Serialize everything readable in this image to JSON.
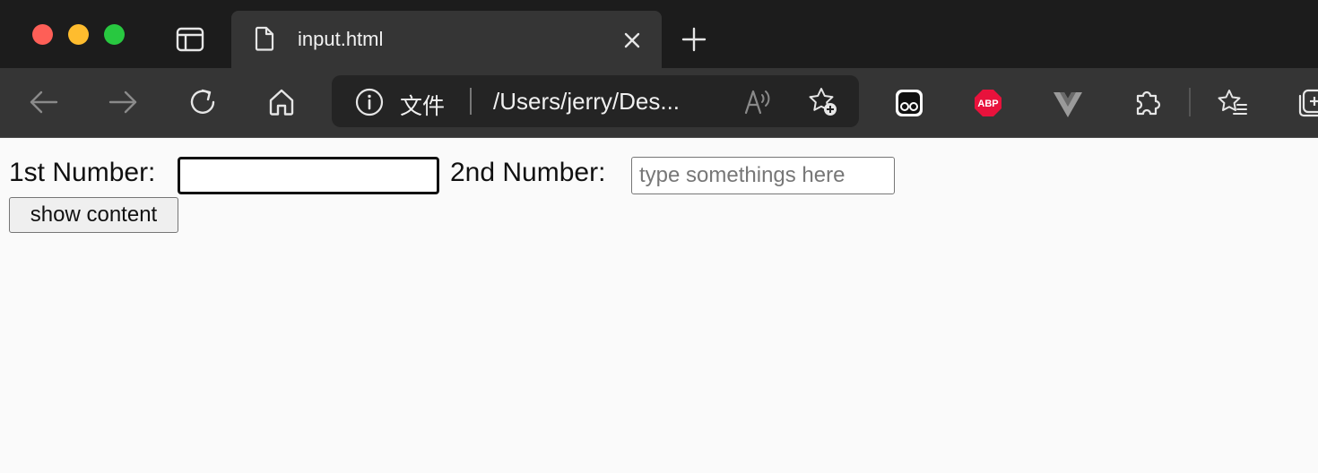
{
  "browser": {
    "tab": {
      "title": "input.html",
      "favicon": "document-icon",
      "close_icon": "close-icon"
    },
    "new_tab_icon": "plus-icon",
    "toolbar": {
      "address_bar": {
        "scheme_label": "文件",
        "url": "/Users/jerry/Des..."
      },
      "extensions": {
        "abp_label": "ABP"
      }
    }
  },
  "page": {
    "first_label": "1st Number:",
    "first_value": "",
    "second_label": "2nd Number:",
    "second_placeholder": "type somethings here",
    "button_label": "show content"
  }
}
